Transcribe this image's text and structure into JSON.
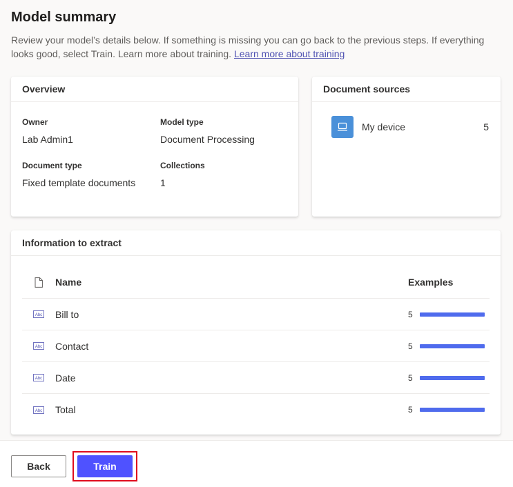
{
  "header": {
    "title": "Model summary",
    "description": "Review your model’s details below. If something is missing you can go back to the previous steps. If everything looks good, select Train. Learn more about training.",
    "link_text": "Learn more about training"
  },
  "overview": {
    "title": "Overview",
    "fields": [
      {
        "label": "Owner",
        "value": "Lab Admin1"
      },
      {
        "label": "Model type",
        "value": "Document Processing"
      },
      {
        "label": "Document type",
        "value": "Fixed template documents"
      },
      {
        "label": "Collections",
        "value": "1"
      }
    ]
  },
  "sources": {
    "title": "Document sources",
    "items": [
      {
        "name": "My device",
        "count": "5",
        "icon": "laptop-icon"
      }
    ]
  },
  "extract": {
    "title": "Information to extract",
    "columns": {
      "name": "Name",
      "examples": "Examples"
    },
    "rows": [
      {
        "name": "Bill to",
        "examples": "5",
        "progress": 1.0
      },
      {
        "name": "Contact",
        "examples": "5",
        "progress": 1.0
      },
      {
        "name": "Date",
        "examples": "5",
        "progress": 1.0
      },
      {
        "name": "Total",
        "examples": "5",
        "progress": 1.0
      }
    ]
  },
  "footer": {
    "back_label": "Back",
    "train_label": "Train"
  },
  "colors": {
    "accent": "#4f52ff",
    "bar": "#4f6bed",
    "source_icon_bg": "#4a90d9",
    "highlight": "#e00b1c"
  }
}
